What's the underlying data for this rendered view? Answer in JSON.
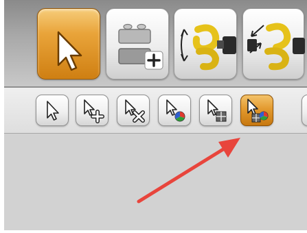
{
  "colors": {
    "accent": "#e39a2f",
    "toolbar_bg": "#a8a8a8",
    "canvas_bg": "#d2d2d2",
    "annotation": "#e8453c"
  },
  "toolbar": {
    "tools": [
      {
        "name": "select-tool",
        "icon": "cursor-arrow-icon",
        "active": true
      },
      {
        "name": "add-brick-tool",
        "icon": "brick-add-icon",
        "active": false
      },
      {
        "name": "rotate-tool",
        "icon": "hinge-rotate-icon",
        "active": false
      },
      {
        "name": "hinge-align-tool",
        "icon": "hinge-align-icon",
        "active": false
      }
    ]
  },
  "sub_toolbar": {
    "modes": [
      {
        "name": "single-select",
        "icon": "pointer-icon",
        "active": false
      },
      {
        "name": "add-to-selection",
        "icon": "pointer-plus-icon",
        "active": false
      },
      {
        "name": "remove-from-selection",
        "icon": "pointer-x-icon",
        "active": false
      },
      {
        "name": "select-by-color",
        "icon": "pointer-color-icon",
        "active": false
      },
      {
        "name": "select-by-shape",
        "icon": "pointer-shape-icon",
        "active": false
      },
      {
        "name": "select-by-color-and-shape",
        "icon": "pointer-color-shape-icon",
        "active": true
      }
    ]
  },
  "annotation": {
    "type": "arrow",
    "icon": "red-arrow",
    "points_to": "select-by-color-and-shape"
  }
}
